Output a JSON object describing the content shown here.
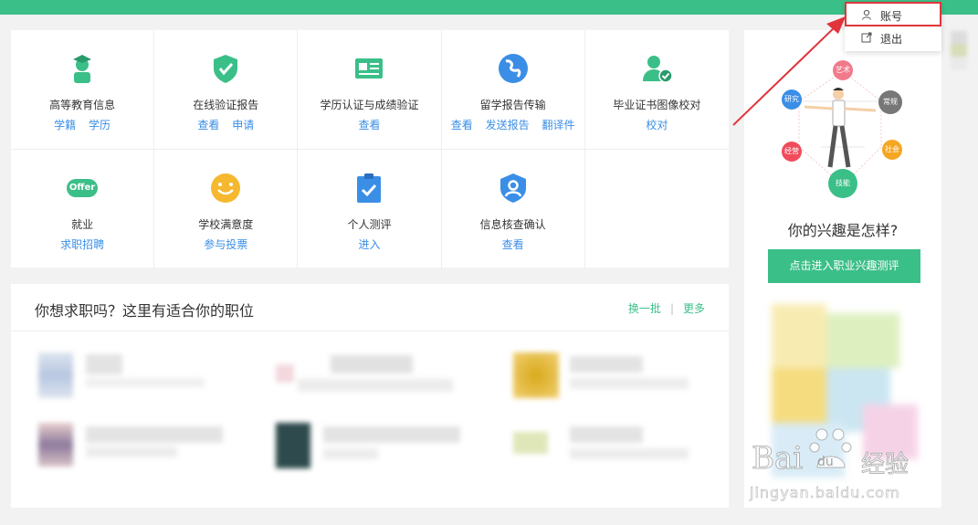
{
  "services": {
    "row1": [
      {
        "title": "高等教育信息",
        "links": [
          "学籍",
          "学历"
        ]
      },
      {
        "title": "在线验证报告",
        "links": [
          "查看",
          "申请"
        ]
      },
      {
        "title": "学历认证与成绩验证",
        "links": [
          "查看"
        ]
      },
      {
        "title": "留学报告传输",
        "links": [
          "查看",
          "发送报告",
          "翻译件"
        ]
      },
      {
        "title": "毕业证书图像校对",
        "links": [
          "校对"
        ]
      }
    ],
    "row2": [
      {
        "title": "就业",
        "links": [
          "求职招聘"
        ],
        "badge": "Offer"
      },
      {
        "title": "学校满意度",
        "links": [
          "参与投票"
        ]
      },
      {
        "title": "个人测评",
        "links": [
          "进入"
        ]
      },
      {
        "title": "信息核查确认",
        "links": [
          "查看"
        ]
      }
    ]
  },
  "jobs": {
    "title": "你想求职吗？这里有适合你的职位",
    "refresh": "换一批",
    "divider": "|",
    "more": "更多"
  },
  "sidebar": {
    "diagram_labels": {
      "art": "艺术",
      "research": "研究",
      "routine": "常规",
      "management": "经营",
      "social": "社会",
      "skill": "技能"
    },
    "question": "你的兴趣是怎样?",
    "button": "点击进入职业兴趣测评"
  },
  "account_menu": {
    "account": "账号",
    "logout": "退出"
  },
  "watermark": {
    "brand": "Bai",
    "brand2": "du",
    "cn": "经验",
    "url": "jingyan.baidu.com"
  },
  "colors": {
    "green": "#3bbf88",
    "blue_link": "#3a8ee6",
    "highlight_red": "#e0353c"
  }
}
